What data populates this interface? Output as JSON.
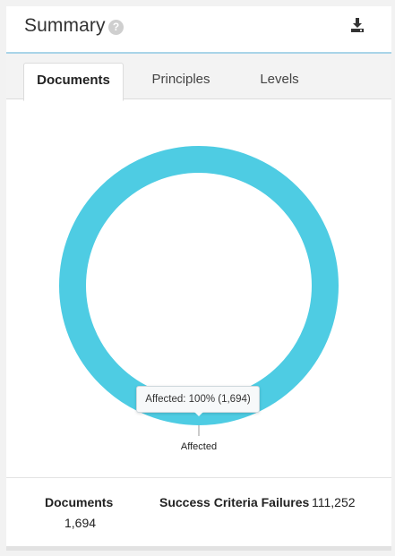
{
  "header": {
    "title": "Summary",
    "help_icon": "question-circle-icon",
    "download_icon": "download-icon"
  },
  "tabs": [
    {
      "label": "Documents",
      "active": true
    },
    {
      "label": "Principles",
      "active": false
    },
    {
      "label": "Levels",
      "active": false
    }
  ],
  "chart_data": {
    "type": "pie",
    "variant": "donut",
    "slices": [
      {
        "label": "Affected",
        "percent": 100,
        "count": 1694,
        "color": "#4ecce3"
      }
    ],
    "tooltip": "Affected: 100% (1,694)",
    "slice_label": "Affected"
  },
  "stats": {
    "documents_label": "Documents",
    "documents_value": "1,694",
    "failures_label": "Success Criteria Failures",
    "failures_value": "111,252"
  }
}
